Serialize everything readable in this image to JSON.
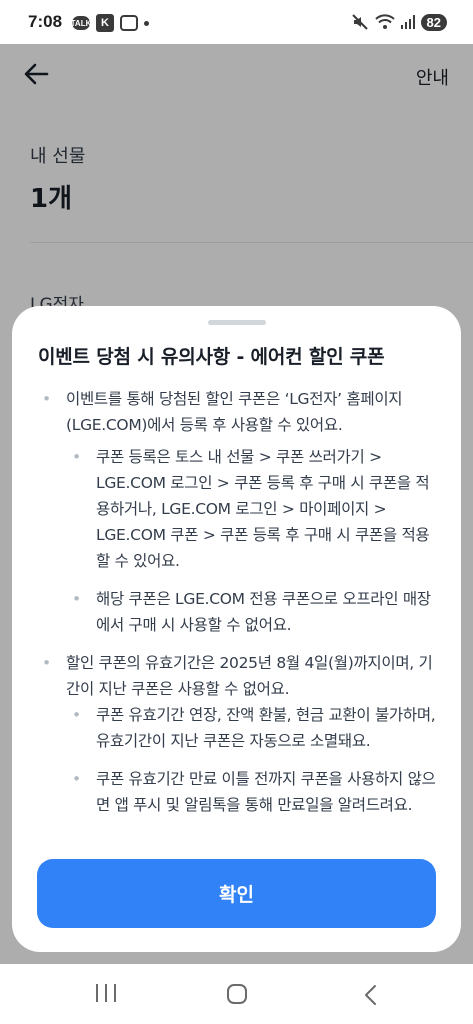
{
  "status_bar": {
    "time": "7:08",
    "talk_icon_text": "TALK",
    "k_icon_text": "K",
    "battery": "82"
  },
  "header": {
    "guide_label": "안내"
  },
  "gift": {
    "label": "내 선물",
    "count": "1개"
  },
  "section_peek": "LG전자",
  "sheet": {
    "title": "이벤트 당첨 시 유의사항 - 에어컨 할인 쿠폰",
    "items": [
      {
        "text": "이벤트를 통해 당첨된 할인 쿠폰은 ‘LG전자’ 홈페이지(LGE.COM)에서 등록 후 사용할 수 있어요."
      },
      {
        "text": "쿠폰 등록은 토스 내 선물 > 쿠폰 쓰러가기 > LGE.COM 로그인 > 쿠폰 등록 후 구매 시 쿠폰을 적용하거나, LGE.COM 로그인 > 마이페이지 > LGE.COM 쿠폰 > 쿠폰 등록 후 구매 시 쿠폰을 적용할 수 있어요."
      },
      {
        "text": "해당 쿠폰은 LGE.COM 전용 쿠폰으로 오프라인 매장에서 구매 시 사용할 수 없어요."
      },
      {
        "text": "할인 쿠폰의 유효기간은 2025년 8월 4일(월)까지이며, 기간이 지난 쿠폰은 사용할 수 없어요."
      },
      {
        "text": "쿠폰 유효기간 연장, 잔액 환불, 현금 교환이 불가하며, 유효기간이 지난 쿠폰은 자동으로 소멸돼요."
      },
      {
        "text": "쿠폰 유효기간 만료 이틀 전까지 쿠폰을 사용하지 않으면 앱 푸시 및 알림톡을 통해 만료일을 알려드려요."
      }
    ],
    "confirm_label": "확인"
  }
}
